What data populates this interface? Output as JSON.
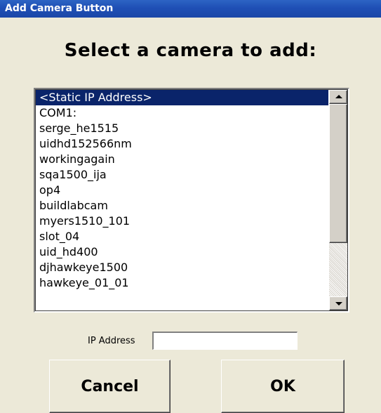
{
  "window": {
    "title": "Add Camera Button"
  },
  "heading": "Select a camera to add:",
  "camera_list": {
    "items": [
      "<Static IP Address>",
      "COM1:",
      "serge_he1515",
      "uidhd152566nm",
      "workingagain",
      "sqa1500_ija",
      "op4",
      "buildlabcam",
      "myers1510_101",
      "slot_04",
      "uid_hd400",
      "djhawkeye1500",
      "hawkeye_01_01"
    ],
    "selected_index": 0
  },
  "ip_address": {
    "label": "IP Address",
    "value": ""
  },
  "buttons": {
    "cancel_label": "Cancel",
    "ok_label": "OK"
  },
  "colors": {
    "title_bar": "#1f4fb5",
    "selection": "#0a246a",
    "dialog_background": "#ece9d8"
  }
}
